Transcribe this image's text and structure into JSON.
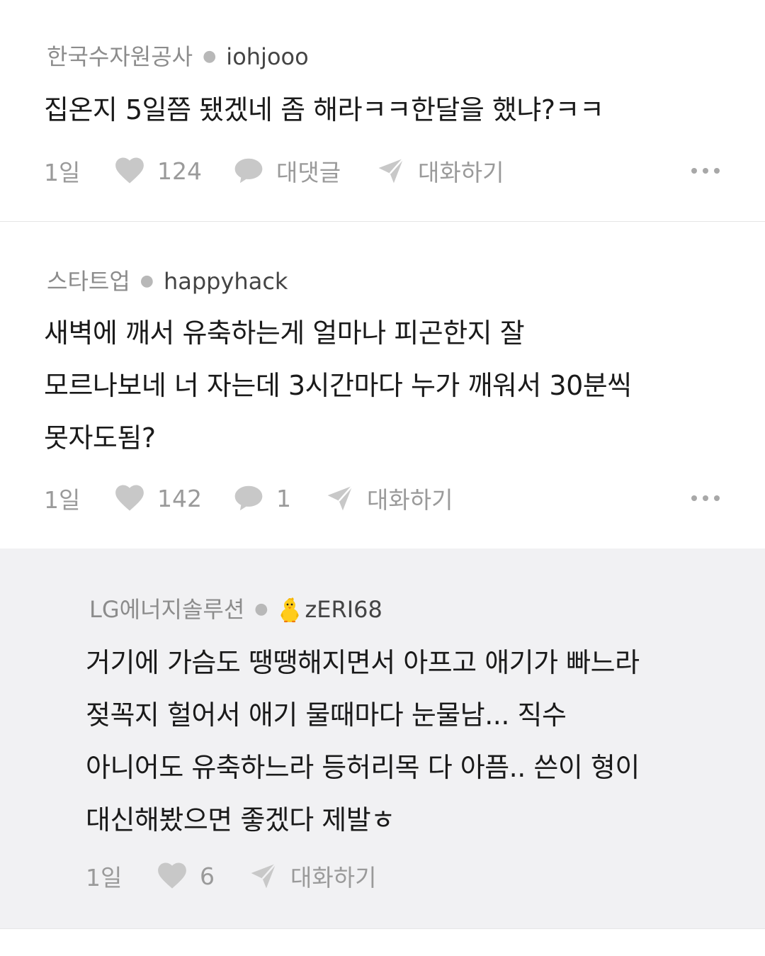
{
  "comments": [
    {
      "company": "한국수자원공사",
      "nickname": "iohjooo",
      "lines": [
        "집온지 5일쯤 됐겠네 좀 해라ㅋㅋ한달을 했냐?ㅋㅋ"
      ],
      "time": "1일",
      "likes": "124",
      "reply_label": "대댓글",
      "chat_label": "대화하기"
    },
    {
      "company": "스타트업",
      "nickname": "happyhack",
      "lines": [
        "새벽에 깨서 유축하는게 얼마나 피곤한지 잘",
        "모르나보네 너 자는데 3시간마다 누가 깨워서 30분씩",
        "못자도됨?"
      ],
      "time": "1일",
      "likes": "142",
      "reply_label": "1",
      "chat_label": "대화하기"
    },
    {
      "company": "LG에너지솔루션",
      "nickname": "zERI68",
      "nickname_icon": "chick-icon",
      "lines": [
        "거기에 가슴도 땡땡해지면서 아프고 애기가 빠느라",
        "젖꼭지 헐어서 애기 물때마다 눈물남... 직수",
        "아니어도 유축하느라 등허리목 다 아픔.. 쓴이 형이",
        "대신해봤으면 좋겠다 제발ㅎ"
      ],
      "time": "1일",
      "likes": "6",
      "chat_label": "대화하기"
    }
  ],
  "colors": {
    "reply_background": "#f1f1f3",
    "meta_gray": "#8c8c8c",
    "action_gray": "#9a9a9a"
  }
}
